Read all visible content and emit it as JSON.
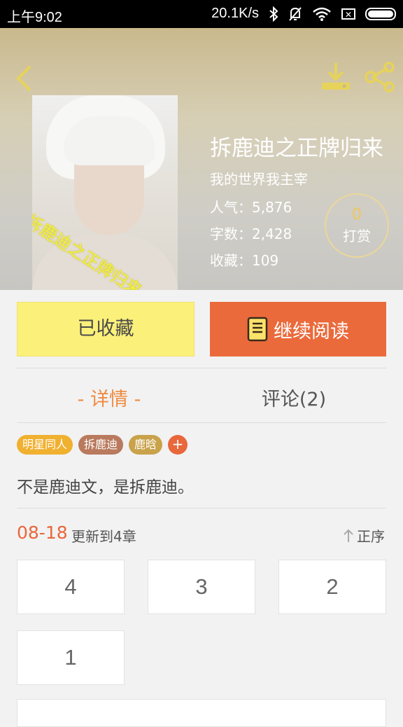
{
  "status_bar": {
    "time": "上午9:02",
    "net_speed": "20.1K/s",
    "icons": [
      "bluetooth-icon",
      "mute-icon",
      "wifi-icon",
      "sim-icon",
      "battery-icon"
    ]
  },
  "book": {
    "title": "拆鹿迪之正牌归来",
    "subtitle": "我的世界我主宰",
    "popularity": "人气：5,876",
    "word_count": "字数：2,428",
    "favorites": "收藏：109",
    "cover_watermark": "拆鹿迪之正牌归来",
    "reward_count": "0",
    "reward_label": "打赏"
  },
  "actions": {
    "favorited_label": "已收藏",
    "continue_label": "继续阅读"
  },
  "tabs": {
    "detail": "- 详情 -",
    "comments": "评论(2)"
  },
  "tags": [
    {
      "label": "明星同人",
      "color": "#f0b030"
    },
    {
      "label": "拆鹿迪",
      "color": "#b97a5e"
    },
    {
      "label": "鹿晗",
      "color": "#c9a24a"
    }
  ],
  "tag_add": "+",
  "description": "不是鹿迪文，是拆鹿迪。",
  "update": {
    "date": "08-18",
    "text": "更新到4章",
    "order_label": "正序"
  },
  "chapters": [
    "4",
    "3",
    "2",
    "1"
  ],
  "colors": {
    "accent": "#e8673b",
    "favorite_button": "#fbf07a",
    "tab_active": "#f08a40"
  }
}
